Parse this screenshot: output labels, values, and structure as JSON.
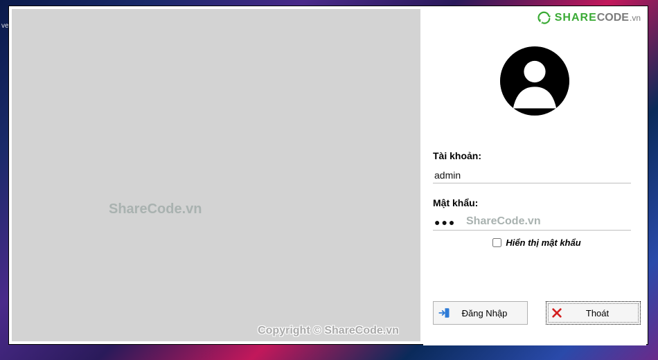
{
  "brand": {
    "part1": "SHARE",
    "part2": "CODE",
    "tld": ".vn",
    "swirl_color": "#3aaa35"
  },
  "form": {
    "username_label": "Tài khoản:",
    "username_value": "admin",
    "password_label": "Mật khẩu:",
    "password_display": "●●●",
    "password_ghost": "ShareCode.vn",
    "show_password_label": "Hiển thị mật khẩu",
    "show_password_checked": false
  },
  "buttons": {
    "login": "Đăng Nhập",
    "exit": "Thoát"
  },
  "watermarks": {
    "center": "ShareCode.vn",
    "footer": "Copyright © ShareCode.vn"
  },
  "crumb_text": "ve"
}
